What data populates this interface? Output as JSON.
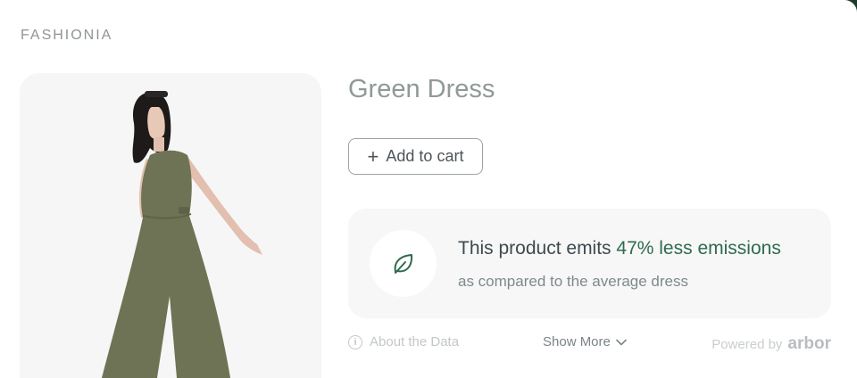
{
  "brand": "FASHIONIA",
  "product": {
    "title": "Green Dress",
    "add_to_cart_label": "Add to cart"
  },
  "emissions": {
    "prefix": "This product emits ",
    "highlight": "47% less emissions",
    "comparison": "as compared to the average dress"
  },
  "footer": {
    "about_label": "About the Data",
    "show_more_label": "Show More",
    "powered_by_label": "Powered by",
    "partner_logo": "arbor"
  },
  "colors": {
    "accent": "#2e6b4f",
    "card_bg": "#f6f7f6",
    "dress": "#6f7355"
  }
}
